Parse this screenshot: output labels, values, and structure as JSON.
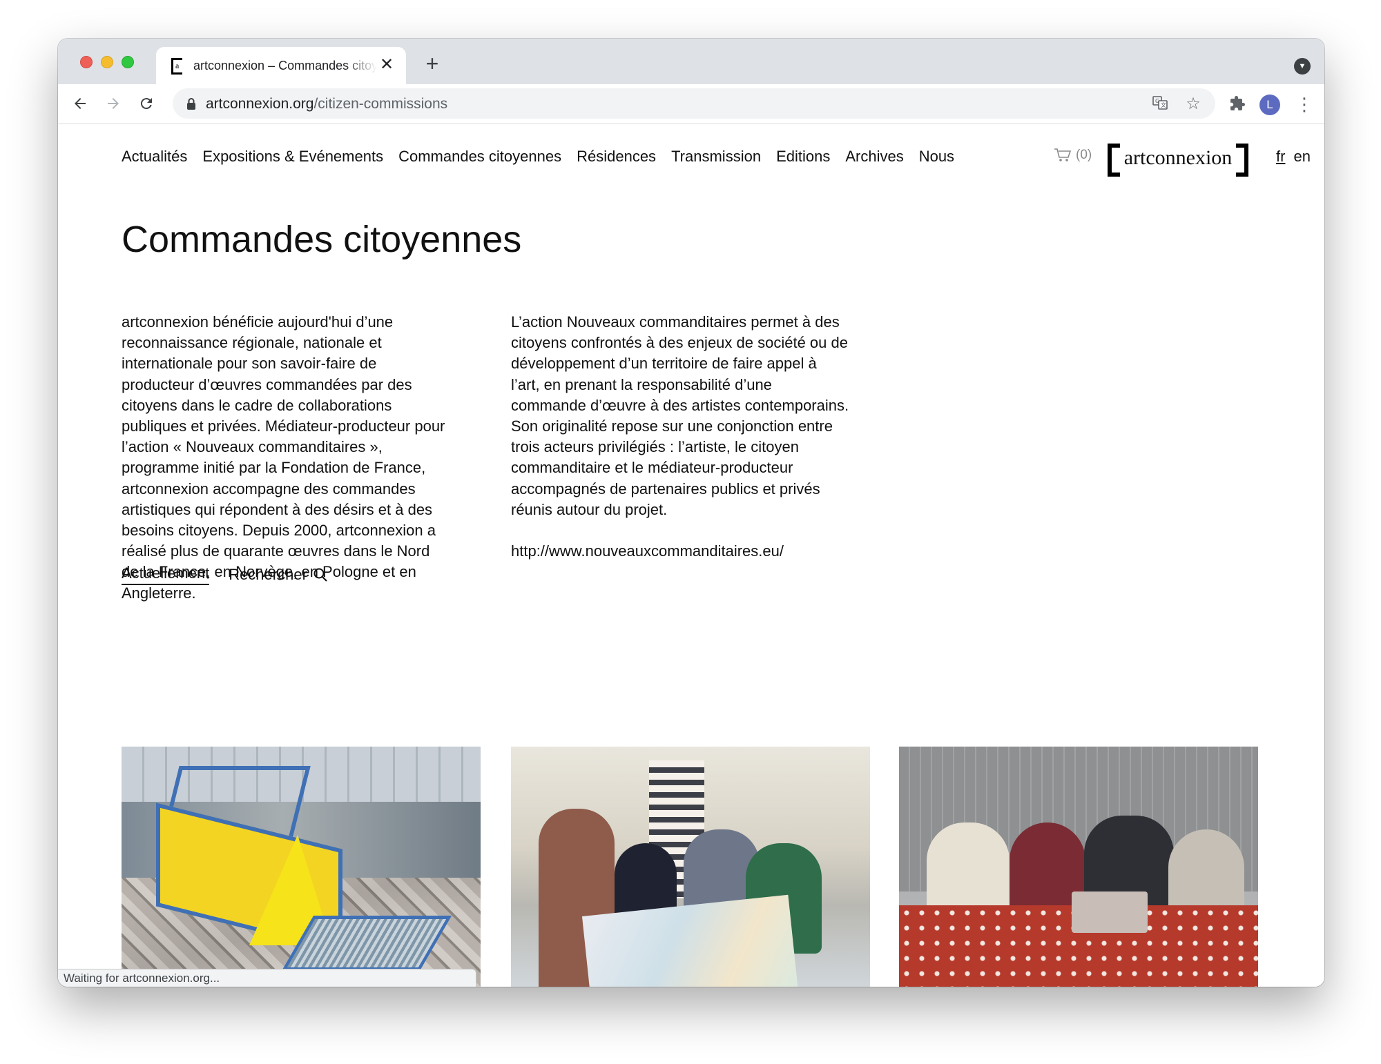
{
  "browser": {
    "tab_title": "artconnexion – Commandes citoyennes",
    "new_tab_label": "+",
    "tab_close_label": "✕",
    "url_domain": "artconnexion.org",
    "url_path": "/citizen-commissions",
    "profile_initial": "L",
    "status_text": "Waiting for artconnexion.org..."
  },
  "nav": {
    "items": [
      {
        "label": "Actualités"
      },
      {
        "label": "Expositions & Evénements"
      },
      {
        "label": "Commandes citoyennes"
      },
      {
        "label": "Résidences"
      },
      {
        "label": "Transmission"
      },
      {
        "label": "Editions"
      },
      {
        "label": "Archives"
      },
      {
        "label": "Nous"
      }
    ],
    "cart_count": "(0)",
    "logo_text": "artconnexion",
    "lang_fr": "fr",
    "lang_en": "en"
  },
  "page": {
    "title": "Commandes citoyennes",
    "intro_left": "artconnexion bénéficie aujourd'hui d’une reconnaissance régionale, nationale et internationale pour son savoir-faire de producteur d’œuvres commandées par des citoyens dans le cadre de collaborations publiques et privées. Médiateur-producteur pour l’action « Nouveaux commanditaires », programme initié par la Fondation de France, artconnexion accompagne des commandes artistiques qui répondent à des désirs et à des besoins citoyens. Depuis 2000, artconnexion a réalisé plus de quarante œuvres dans le Nord de la France, en Norvège, en Pologne et en Angleterre.",
    "intro_right": "L’action Nouveaux commanditaires permet à des citoyens confrontés à des enjeux de société ou de développement d’un territoire de faire appel à l’art, en prenant la responsabilité d’une commande d’œuvre à des artistes contemporains. Son originalité repose sur une conjonction entre trois acteurs privilégiés : l’artiste, le citoyen commanditaire et le médiateur-producteur accompagnés de partenaires publics et privés réunis autour du projet.",
    "link": "http://www.nouveauxcommanditaires.eu/"
  },
  "filters": {
    "current": "Actuellement",
    "search": "Rechercher"
  },
  "icons": {
    "back": "arrow-left-icon",
    "forward": "arrow-right-icon",
    "reload": "reload-icon",
    "lock": "lock-icon",
    "translate": "translate-icon",
    "bookmark": "star-icon",
    "extensions": "puzzle-icon",
    "menu": "more-vert-icon",
    "cart": "cart-icon",
    "search": "search-icon"
  },
  "colors": {
    "traffic_red": "#ee5f57",
    "traffic_yellow": "#f5bd2e",
    "traffic_green": "#2fc840",
    "avatar": "#5c6bc0"
  }
}
